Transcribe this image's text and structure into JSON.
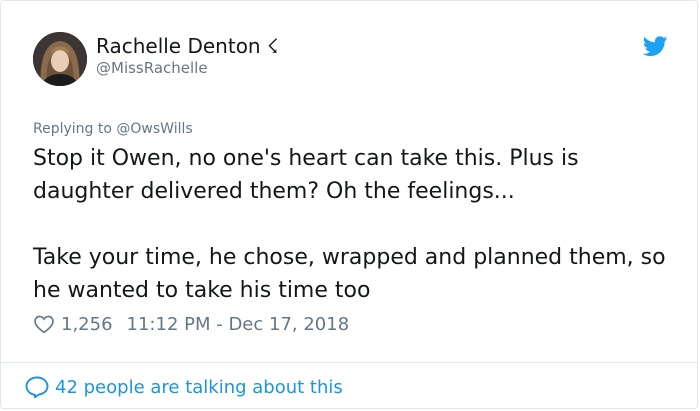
{
  "tweet": {
    "author_name": "Rachelle Denton ☇",
    "author_handle": "@MissRachelle",
    "replying_prefix": "Replying to ",
    "replying_to": "@OwsWills",
    "paragraphs": [
      "Stop it Owen, no one's heart can take this. Plus is daughter delivered them? Oh the feelings...",
      "Take your time, he chose, wrapped and planned them, so he wanted to take his time too"
    ],
    "like_count": "1,256",
    "timestamp": "11:12 PM - Dec 17, 2018"
  },
  "footer": {
    "conversation_text": "42 people are talking about this"
  },
  "colors": {
    "twitter_blue": "#1da1f2",
    "link_blue": "#1b95e0",
    "muted_gray": "#657786",
    "text_dark": "#14171a"
  },
  "icons": {
    "brand": "twitter-bird-icon",
    "like": "heart-outline-icon",
    "reply": "speech-bubble-icon"
  }
}
